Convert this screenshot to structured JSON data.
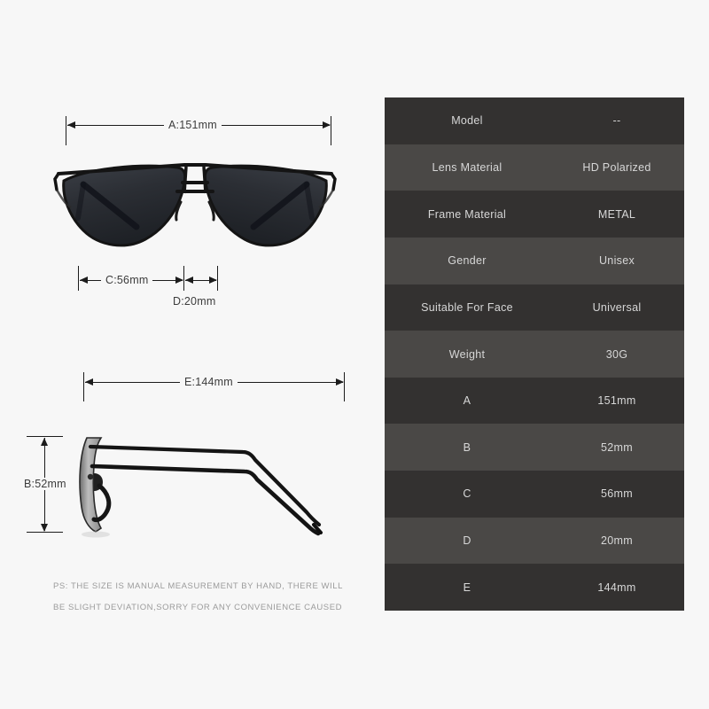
{
  "page": {
    "background_color": "#f7f7f7",
    "note_line_1": "PS: THE SIZE IS MANUAL MEASUREMENT BY HAND, THERE WILL",
    "note_line_2": "BE SLIGHT DEVIATION,SORRY FOR ANY CONVENIENCE CAUSED"
  },
  "diagram": {
    "front_view": {
      "width_label": "A:151mm",
      "lens_label": "C:56mm",
      "bridge_label": "D:20mm"
    },
    "side_view": {
      "temple_label": "E:144mm",
      "height_label": "B:52mm"
    }
  },
  "spec_table": {
    "row_color_odd": "#333130",
    "row_color_even": "#4a4846",
    "text_color": "#d7d7d7",
    "rows": [
      {
        "label": "Model",
        "value": "--"
      },
      {
        "label": "Lens Material",
        "value": "HD Polarized"
      },
      {
        "label": "Frame Material",
        "value": "METAL"
      },
      {
        "label": "Gender",
        "value": "Unisex"
      },
      {
        "label": "Suitable For Face",
        "value": "Universal"
      },
      {
        "label": "Weight",
        "value": "30G"
      },
      {
        "label": "A",
        "value": "151mm"
      },
      {
        "label": "B",
        "value": "52mm"
      },
      {
        "label": "C",
        "value": "56mm"
      },
      {
        "label": "D",
        "value": "20mm"
      },
      {
        "label": "E",
        "value": "144mm"
      }
    ]
  }
}
